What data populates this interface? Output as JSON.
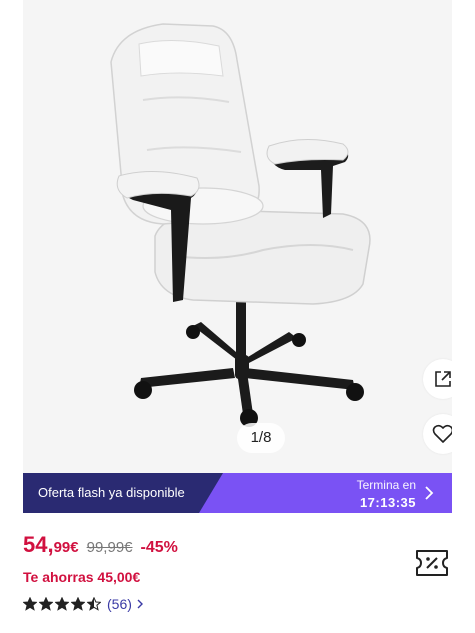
{
  "gallery": {
    "counter": "1/8",
    "share_icon": "share-external-icon",
    "favorite_icon": "heart-outline-icon",
    "image": "white office chair"
  },
  "flash": {
    "label": "Oferta flash ya disponible",
    "ends_label": "Termina en",
    "time": "17:13:35",
    "colors": {
      "left": "#2a2a72",
      "right": "#7a52f4"
    }
  },
  "price": {
    "integer": "54,",
    "decimal": "99€",
    "old": "99,99€",
    "discount": "-45%",
    "savings": "Te ahorras 45,00€",
    "accent": "#d1103f"
  },
  "rating": {
    "stars": 4.5,
    "reviews": "(56)"
  },
  "coupon_icon": "coupon-ticket-icon"
}
